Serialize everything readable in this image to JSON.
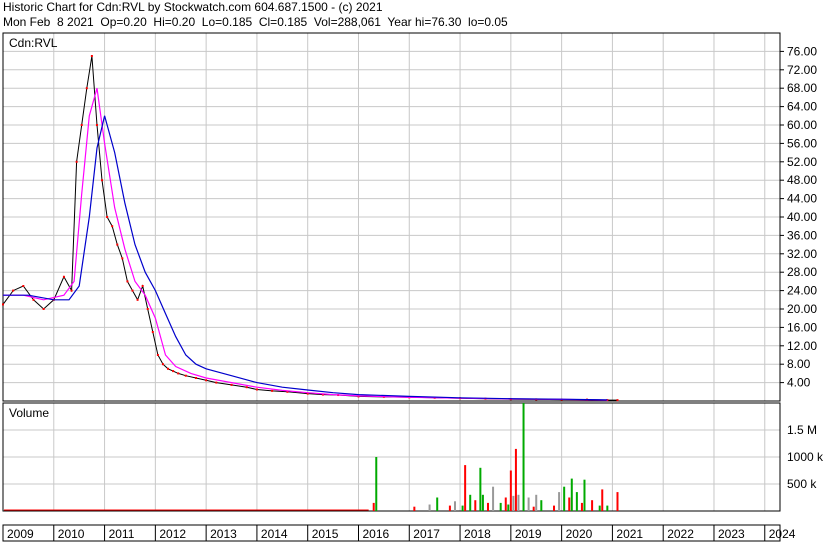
{
  "header": {
    "line1": "Historic Chart for Cdn:RVL by Stockwatch.com 604.687.1500 - (c) 2021",
    "line2": "Mon Feb  8 2021  Op=0.20  Hi=0.20  Lo=0.185  Cl=0.185  Vol=288,061  Year hi=76.30  lo=0.05"
  },
  "colors": {
    "grid": "#c8c8c8",
    "price": "#000000",
    "close_dots": "#ff0000",
    "ma_short": "#ff00ff",
    "ma_long": "#0000cc",
    "vol_up": "#00aa00",
    "vol_down": "#ff0000",
    "vol_flat": "#999999"
  },
  "chart_data": [
    {
      "type": "line",
      "title": "Cdn:RVL",
      "x_years": [
        "2009",
        "2010",
        "2011",
        "2012",
        "2013",
        "2014",
        "2015",
        "2016",
        "2017",
        "2018",
        "2019",
        "2020",
        "2021",
        "2022",
        "2023",
        "2024"
      ],
      "ylim": [
        0,
        80
      ],
      "y_ticks": [
        4,
        8,
        12,
        16,
        20,
        24,
        28,
        32,
        36,
        40,
        44,
        48,
        52,
        56,
        60,
        64,
        68,
        72,
        76
      ],
      "y_tick_labels": [
        "4.00",
        "8.00",
        "12.00",
        "16.00",
        "20.00",
        "24.00",
        "28.00",
        "32.00",
        "36.00",
        "40.00",
        "44.00",
        "48.00",
        "52.00",
        "56.00",
        "60.00",
        "64.00",
        "68.00",
        "72.00",
        "76.00"
      ],
      "series": [
        {
          "role": "price_close",
          "x": [
            2009.0,
            2009.2,
            2009.4,
            2009.6,
            2009.8,
            2010.0,
            2010.2,
            2010.35,
            2010.45,
            2010.55,
            2010.65,
            2010.75,
            2010.85,
            2010.95,
            2011.05,
            2011.15,
            2011.25,
            2011.35,
            2011.45,
            2011.55,
            2011.65,
            2011.75,
            2011.85,
            2011.95,
            2012.05,
            2012.15,
            2012.25,
            2012.35,
            2012.45,
            2012.6,
            2012.8,
            2013.0,
            2013.2,
            2013.5,
            2013.8,
            2014.0,
            2014.3,
            2014.6,
            2015.0,
            2015.3,
            2015.6,
            2016.0,
            2016.5,
            2017.0,
            2017.5,
            2018.0,
            2018.5,
            2019.0,
            2019.5,
            2020.0,
            2020.5,
            2020.9,
            2021.1
          ],
          "y": [
            21,
            24,
            25,
            22,
            20,
            22,
            27,
            24,
            52,
            60,
            68,
            75,
            60,
            48,
            40,
            38,
            34,
            31,
            26,
            24,
            22,
            25,
            20,
            15,
            10,
            8,
            7,
            6.5,
            6,
            5.5,
            5,
            4.5,
            4,
            3.5,
            3,
            2.5,
            2.2,
            2.0,
            1.6,
            1.4,
            1.3,
            1.0,
            0.9,
            0.8,
            0.7,
            0.6,
            0.5,
            0.4,
            0.35,
            0.3,
            0.3,
            0.2,
            0.185
          ]
        },
        {
          "role": "moving_average_short",
          "x": [
            2009.0,
            2009.4,
            2009.8,
            2010.2,
            2010.4,
            2010.55,
            2010.7,
            2010.85,
            2011.0,
            2011.2,
            2011.4,
            2011.6,
            2011.8,
            2012.0,
            2012.2,
            2012.4,
            2012.7,
            2013.0,
            2013.5,
            2014.0,
            2014.5,
            2015.0,
            2015.5,
            2016.0,
            2017.0,
            2018.0,
            2019.0,
            2020.0,
            2020.9
          ],
          "y": [
            23,
            23,
            22,
            23,
            26,
            45,
            62,
            68,
            56,
            42,
            33,
            26,
            23,
            18,
            10,
            7.5,
            6,
            5,
            4,
            3,
            2.3,
            1.8,
            1.4,
            1.1,
            0.8,
            0.6,
            0.45,
            0.35,
            0.2
          ]
        },
        {
          "role": "moving_average_long",
          "x": [
            2009.0,
            2009.5,
            2010.0,
            2010.3,
            2010.5,
            2010.7,
            2010.85,
            2011.0,
            2011.2,
            2011.4,
            2011.6,
            2011.8,
            2012.0,
            2012.2,
            2012.4,
            2012.6,
            2012.8,
            2013.0,
            2013.5,
            2014.0,
            2014.5,
            2015.0,
            2015.5,
            2016.0,
            2017.0,
            2018.0,
            2019.0,
            2020.0,
            2020.9
          ],
          "y": [
            23,
            23,
            22,
            22,
            25,
            40,
            55,
            62,
            54,
            43,
            34,
            28,
            24,
            19,
            14,
            10,
            8,
            7,
            5.5,
            4,
            3,
            2.4,
            1.8,
            1.4,
            1.0,
            0.7,
            0.5,
            0.4,
            0.25
          ]
        }
      ]
    },
    {
      "type": "bar",
      "title": "Volume",
      "ylim": [
        0,
        2000000
      ],
      "y_ticks": [
        500000,
        1000000,
        1500000
      ],
      "y_tick_labels": [
        "500 k",
        "1000 k",
        "1.5 M"
      ],
      "x": [
        2016.3,
        2016.35,
        2017.1,
        2017.4,
        2017.55,
        2017.8,
        2017.9,
        2018.05,
        2018.1,
        2018.2,
        2018.3,
        2018.4,
        2018.45,
        2018.55,
        2018.65,
        2018.8,
        2018.9,
        2018.95,
        2019.0,
        2019.05,
        2019.1,
        2019.15,
        2019.25,
        2019.35,
        2019.45,
        2019.5,
        2019.6,
        2019.85,
        2019.95,
        2020.05,
        2020.15,
        2020.2,
        2020.3,
        2020.4,
        2020.45,
        2020.6,
        2020.75,
        2020.8,
        2020.9,
        2021.1
      ],
      "values": [
        150000,
        1000000,
        80000,
        120000,
        250000,
        100000,
        180000,
        100000,
        850000,
        300000,
        200000,
        800000,
        300000,
        150000,
        450000,
        150000,
        250000,
        120000,
        750000,
        280000,
        1150000,
        300000,
        2000000,
        250000,
        80000,
        300000,
        200000,
        100000,
        350000,
        450000,
        250000,
        600000,
        350000,
        150000,
        580000,
        200000,
        100000,
        400000,
        100000,
        350000
      ]
    }
  ],
  "volume_up_index": [
    1,
    4,
    7,
    9,
    11,
    12,
    15,
    17,
    22,
    26,
    29,
    31,
    32,
    34,
    36,
    38
  ],
  "volume_down_index": [
    0,
    2,
    5,
    8,
    10,
    13,
    16,
    18,
    20,
    24,
    27,
    30,
    33,
    35,
    37,
    39
  ]
}
